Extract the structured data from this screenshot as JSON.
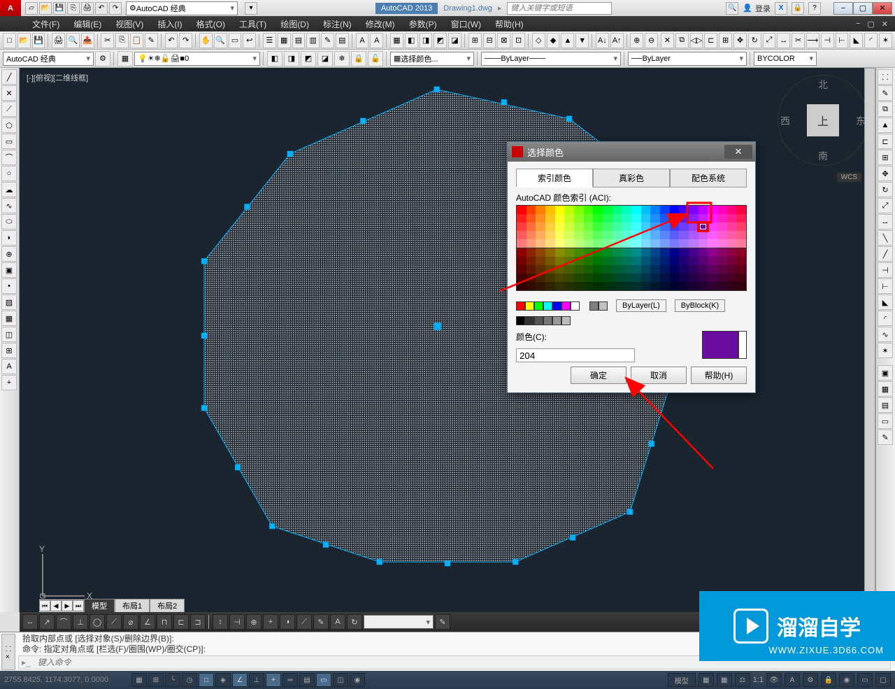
{
  "title": {
    "app": "AutoCAD 2013",
    "doc": "Drawing1.dwg",
    "workspace": "AutoCAD 经典",
    "search_placeholder": "键入关键字或短语",
    "login": "登录"
  },
  "menu": [
    "文件(F)",
    "编辑(E)",
    "视图(V)",
    "插入(I)",
    "格式(O)",
    "工具(T)",
    "绘图(D)",
    "标注(N)",
    "修改(M)",
    "参数(P)",
    "窗口(W)",
    "帮助(H)"
  ],
  "toolbar2": {
    "workspace": "AutoCAD 经典",
    "zero": "0",
    "select_color": "选择颜色...",
    "bylayer1": "ByLayer",
    "bylayer2": "ByLayer",
    "bycolor": "BYCOLOR"
  },
  "view_label": "[-][俯视][二维线框]",
  "viewcube": {
    "n": "北",
    "s": "南",
    "e": "东",
    "w": "西",
    "top": "上",
    "wcs": "WCS"
  },
  "tabs": {
    "model": "模型",
    "layout1": "布局1",
    "layout2": "布局2"
  },
  "cmd": {
    "line1": "拾取内部点或 [选择对象(S)/删除边界(B)]:",
    "line2": "命令: 指定对角点或 [栏选(F)/圈围(WP)/圈交(CP)]:",
    "placeholder": "键入命令"
  },
  "status": {
    "coords": "2755.8425, 1174.3077, 0.0000",
    "model": "模型",
    "scale": "1:1"
  },
  "dialog": {
    "title": "选择颜色",
    "tabs": [
      "索引颜色",
      "真彩色",
      "配色系统"
    ],
    "aci": "AutoCAD 颜色索引 (ACI):",
    "bylayer": "ByLayer(L)",
    "byblock": "ByBlock(K)",
    "color_label": "颜色(C):",
    "color_value": "204",
    "ok": "确定",
    "cancel": "取消",
    "help": "帮助(H)",
    "preview_color": "#6a0d9e"
  },
  "watermark": {
    "brand": "溜溜自学",
    "url": "WWW.ZIXUE.3D66.COM"
  }
}
